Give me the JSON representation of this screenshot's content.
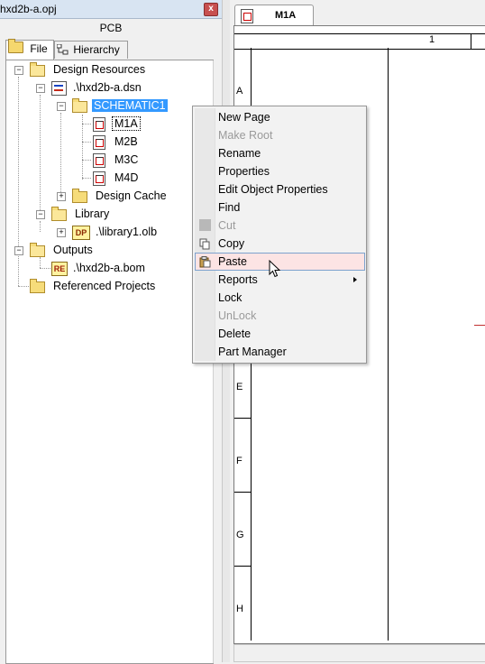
{
  "window": {
    "title": "hxd2b-a.opj",
    "close_glyph": "x"
  },
  "pcb_header": "PCB",
  "tabs": [
    {
      "label": "File",
      "icon": "folder-icon",
      "active": true
    },
    {
      "label": "Hierarchy",
      "icon": "hierarchy-icon",
      "active": false
    }
  ],
  "tree": {
    "design_resources": "Design Resources",
    "dsn": ".\\hxd2b-a.dsn",
    "schematic": "SCHEMATIC1",
    "pages": [
      "M1A",
      "M2B",
      "M3C",
      "M4D"
    ],
    "design_cache": "Design Cache",
    "library": "Library",
    "library_file": ".\\library1.olb",
    "outputs": "Outputs",
    "bom": ".\\hxd2b-a.bom",
    "referenced": "Referenced Projects",
    "lib_icon_text": "DP",
    "bom_icon_text": "RE"
  },
  "document_tab": {
    "label": "M1A"
  },
  "schematic": {
    "column_number": "1",
    "row_labels": [
      "A",
      "E",
      "F",
      "G",
      "H"
    ]
  },
  "context_menu": {
    "items": [
      {
        "label": "New Page",
        "disabled": false
      },
      {
        "label": "Make Root",
        "disabled": true
      },
      {
        "label": "Rename",
        "disabled": false
      },
      {
        "label": "Properties",
        "disabled": false
      },
      {
        "label": "Edit Object Properties",
        "disabled": false
      },
      {
        "label": "Find",
        "disabled": false
      },
      {
        "label": "Cut",
        "disabled": true,
        "icon": "cut-icon"
      },
      {
        "label": "Copy",
        "disabled": false,
        "icon": "copy-icon"
      },
      {
        "label": "Paste",
        "disabled": false,
        "icon": "paste-icon",
        "hovered": true
      },
      {
        "label": "Reports",
        "disabled": false,
        "submenu": true
      },
      {
        "label": "Lock",
        "disabled": false
      },
      {
        "label": "UnLock",
        "disabled": true
      },
      {
        "label": "Delete",
        "disabled": false
      },
      {
        "label": "Part Manager",
        "disabled": false
      }
    ]
  },
  "colors": {
    "selection": "#3399ff",
    "menu_hover": "#fce4e4",
    "menu_hover_border": "#7da2ce"
  }
}
